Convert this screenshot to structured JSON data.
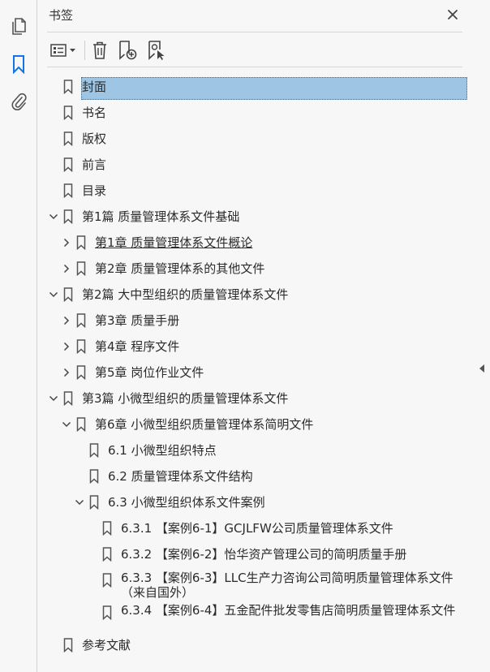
{
  "panel": {
    "title": "书签"
  },
  "toolbar": {
    "icons": [
      "options-list-icon",
      "delete-icon",
      "new-bookmark-icon",
      "bookmark-from-selection-icon"
    ]
  },
  "rail": {
    "icons": [
      "pages-icon",
      "bookmarks-icon",
      "attachments-icon"
    ]
  },
  "bookmarks": [
    {
      "label": "封面",
      "level": 0,
      "chevron": "none",
      "selected": true,
      "underline": false
    },
    {
      "label": "书名",
      "level": 0,
      "chevron": "none",
      "selected": false,
      "underline": false
    },
    {
      "label": "版权",
      "level": 0,
      "chevron": "none",
      "selected": false,
      "underline": false
    },
    {
      "label": "前言",
      "level": 0,
      "chevron": "none",
      "selected": false,
      "underline": false
    },
    {
      "label": "目录",
      "level": 0,
      "chevron": "none",
      "selected": false,
      "underline": false
    },
    {
      "label": "第1篇  质量管理体系文件基础",
      "level": 0,
      "chevron": "down",
      "selected": false,
      "underline": false
    },
    {
      "label": "第1章  质量管理体系文件概论",
      "level": 1,
      "chevron": "right",
      "selected": false,
      "underline": true
    },
    {
      "label": "第2章  质量管理体系的其他文件",
      "level": 1,
      "chevron": "right",
      "selected": false,
      "underline": false
    },
    {
      "label": "第2篇  大中型组织的质量管理体系文件",
      "level": 0,
      "chevron": "down",
      "selected": false,
      "underline": false
    },
    {
      "label": "第3章  质量手册",
      "level": 1,
      "chevron": "right",
      "selected": false,
      "underline": false
    },
    {
      "label": "第4章  程序文件",
      "level": 1,
      "chevron": "right",
      "selected": false,
      "underline": false
    },
    {
      "label": "第5章  岗位作业文件",
      "level": 1,
      "chevron": "right",
      "selected": false,
      "underline": false
    },
    {
      "label": "第3篇  小微型组织的质量管理体系文件",
      "level": 0,
      "chevron": "down",
      "selected": false,
      "underline": false
    },
    {
      "label": "第6章  小微型组织质量管理体系简明文件",
      "level": 1,
      "chevron": "down",
      "selected": false,
      "underline": false
    },
    {
      "label": "6.1  小微型组织特点",
      "level": 2,
      "chevron": "none",
      "selected": false,
      "underline": false
    },
    {
      "label": "6.2  质量管理体系文件结构",
      "level": 2,
      "chevron": "none",
      "selected": false,
      "underline": false
    },
    {
      "label": "6.3  小微型组织体系文件案例",
      "level": 2,
      "chevron": "down",
      "selected": false,
      "underline": false
    },
    {
      "label": "6.3.1  【案例6-1】GCJLFW公司质量管理体系文件",
      "level": 3,
      "chevron": "none",
      "selected": false,
      "underline": false
    },
    {
      "label": "6.3.2  【案例6-2】怡华资产管理公司的简明质量手册",
      "level": 3,
      "chevron": "none",
      "selected": false,
      "underline": false
    },
    {
      "label": "6.3.3  【案例6-3】LLC生产力咨询公司简明质量管理体系文件（来自国外）",
      "level": 3,
      "chevron": "none",
      "selected": false,
      "underline": false
    },
    {
      "label": "6.3.4  【案例6-4】五金配件批发零售店简明质量管理体系文件",
      "level": 3,
      "chevron": "none",
      "selected": false,
      "underline": false
    },
    {
      "label": "参考文献",
      "level": 0,
      "chevron": "none",
      "selected": false,
      "underline": false
    }
  ]
}
